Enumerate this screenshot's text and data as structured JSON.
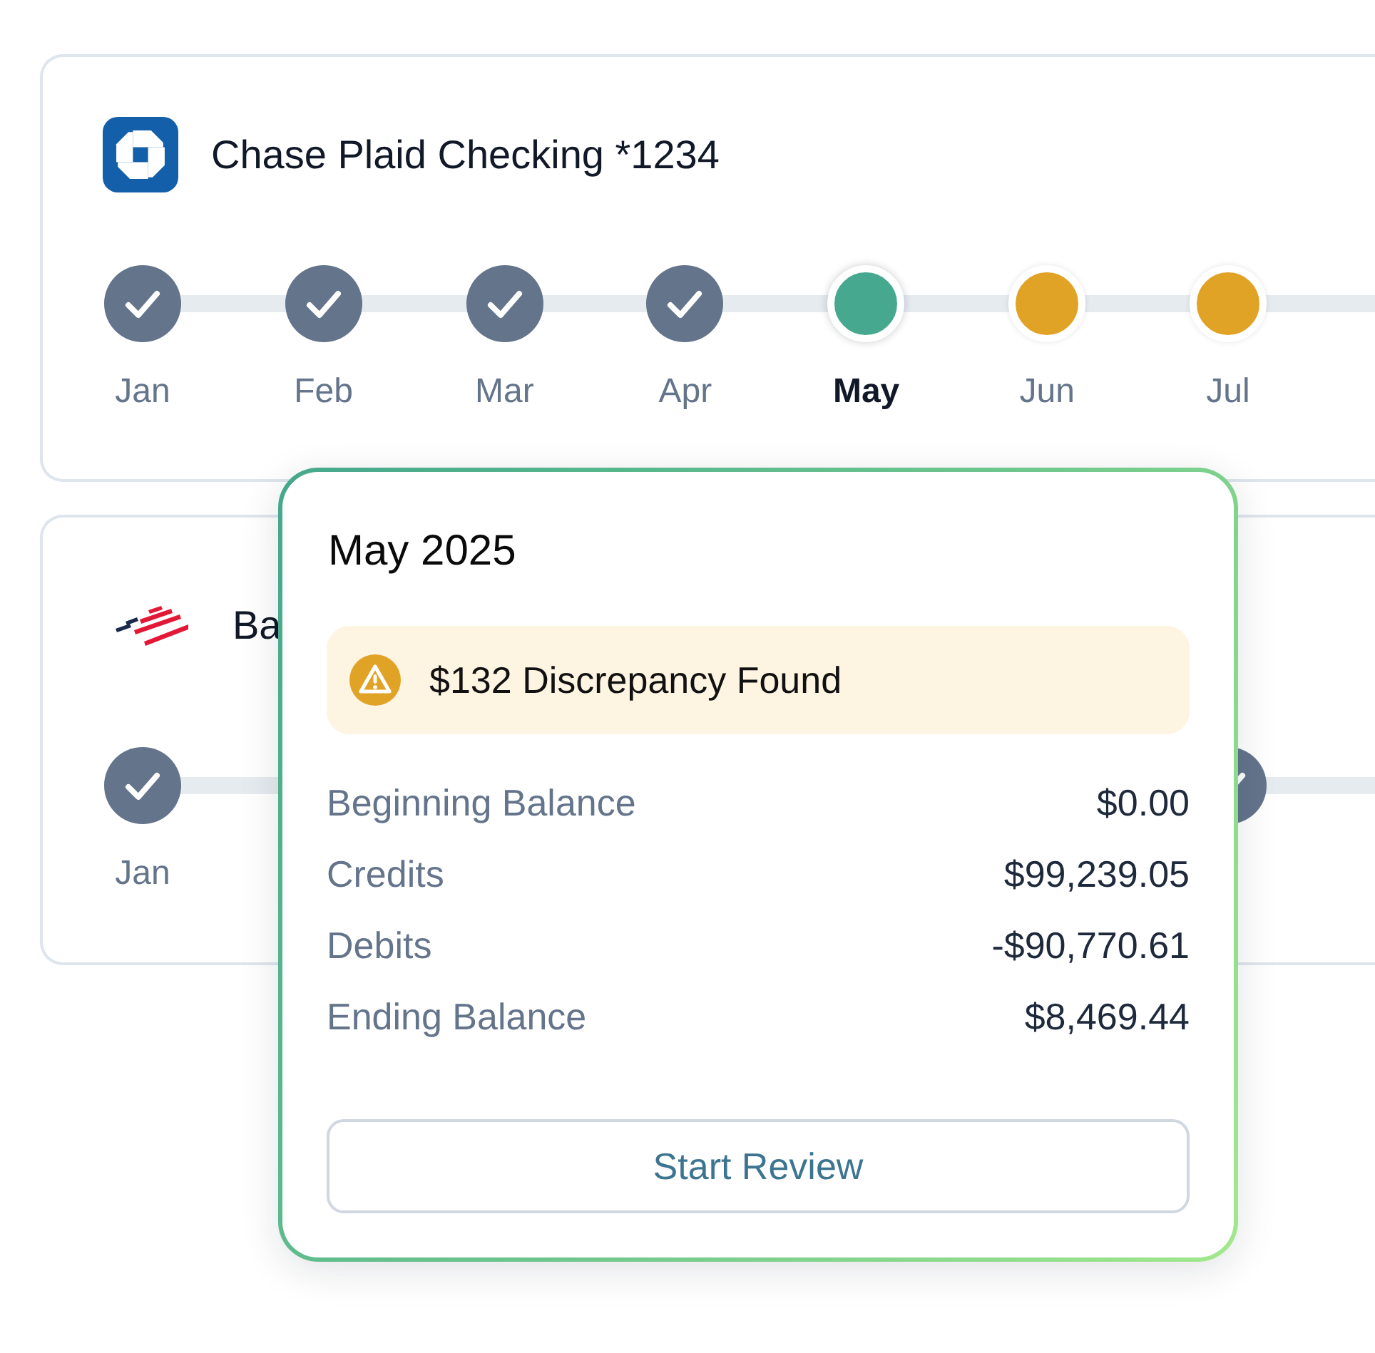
{
  "accounts": [
    {
      "kind": "tile",
      "name": "Chase Plaid Checking *1234",
      "steps": [
        {
          "label": "Jan",
          "kind": "done",
          "selected": false
        },
        {
          "label": "Feb",
          "kind": "done",
          "selected": false
        },
        {
          "label": "Mar",
          "kind": "done",
          "selected": false
        },
        {
          "label": "Apr",
          "kind": "done",
          "selected": false
        },
        {
          "label": "May",
          "kind": "current",
          "selected": true
        },
        {
          "label": "Jun",
          "kind": "pending",
          "selected": false
        },
        {
          "label": "Jul",
          "kind": "pending",
          "selected": false
        }
      ]
    },
    {
      "kind": "flag",
      "name": "Ba",
      "steps": [
        {
          "label": "Jan",
          "kind": "done",
          "selected": false
        },
        {
          "kind": "done",
          "selected": false
        }
      ]
    }
  ],
  "popover": {
    "title": "May 2025",
    "alert": {
      "kind": "warning",
      "text": "$132 Discrepancy Found"
    },
    "rows": [
      {
        "label": "Beginning Balance",
        "value": "$0.00"
      },
      {
        "label": "Credits",
        "value": "$99,239.05"
      },
      {
        "label": "Debits",
        "value": "-$90,770.61"
      },
      {
        "label": "Ending Balance",
        "value": "$8,469.44"
      }
    ],
    "button": "Start Review"
  }
}
